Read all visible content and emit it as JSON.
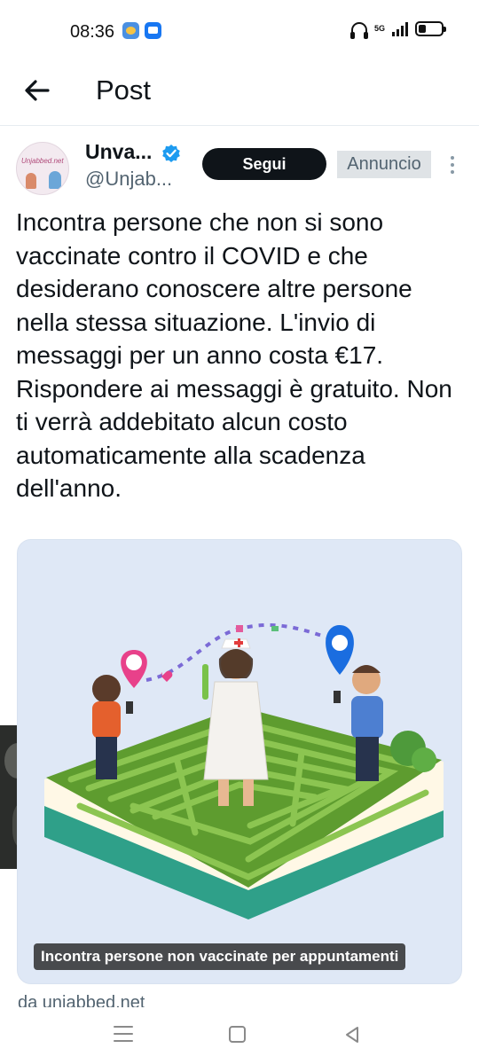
{
  "status_bar": {
    "time": "08:36",
    "network_label": "5G",
    "battery_level": 0.35
  },
  "header": {
    "title": "Post",
    "back_icon": "arrow-left-icon"
  },
  "post": {
    "author_name": "Unva...",
    "author_handle": "@Unjab...",
    "avatar_text": "Unjabbed.net",
    "verified": true,
    "follow_label": "Segui",
    "ad_label": "Annuncio",
    "more_icon": "more-vertical-icon",
    "text": "Incontra persone che non si sono vaccinate contro il COVID e che desiderano conoscere altre persone nella stessa situazione. L'invio di messaggi per un anno costa €17. Rispondere ai messaggi è gratuito. Non ti verrà addebitato alcun costo automaticamente alla scadenza dell'anno.",
    "media_caption": "Incontra persone non vaccinate per appuntamenti",
    "source": "da unjabbed.net"
  },
  "colors": {
    "text_primary": "#0f1419",
    "text_secondary": "#536471",
    "verified_blue": "#1d9bf0",
    "follow_bg": "#0f1419",
    "ad_badge_bg": "#dfe3e6",
    "pin_pink": "#e8418a",
    "pin_blue": "#1a6de0",
    "hedge_green": "#6aa83a"
  },
  "navbar": {
    "icons": [
      "menu-icon",
      "home-square-icon",
      "back-triangle-icon"
    ]
  }
}
